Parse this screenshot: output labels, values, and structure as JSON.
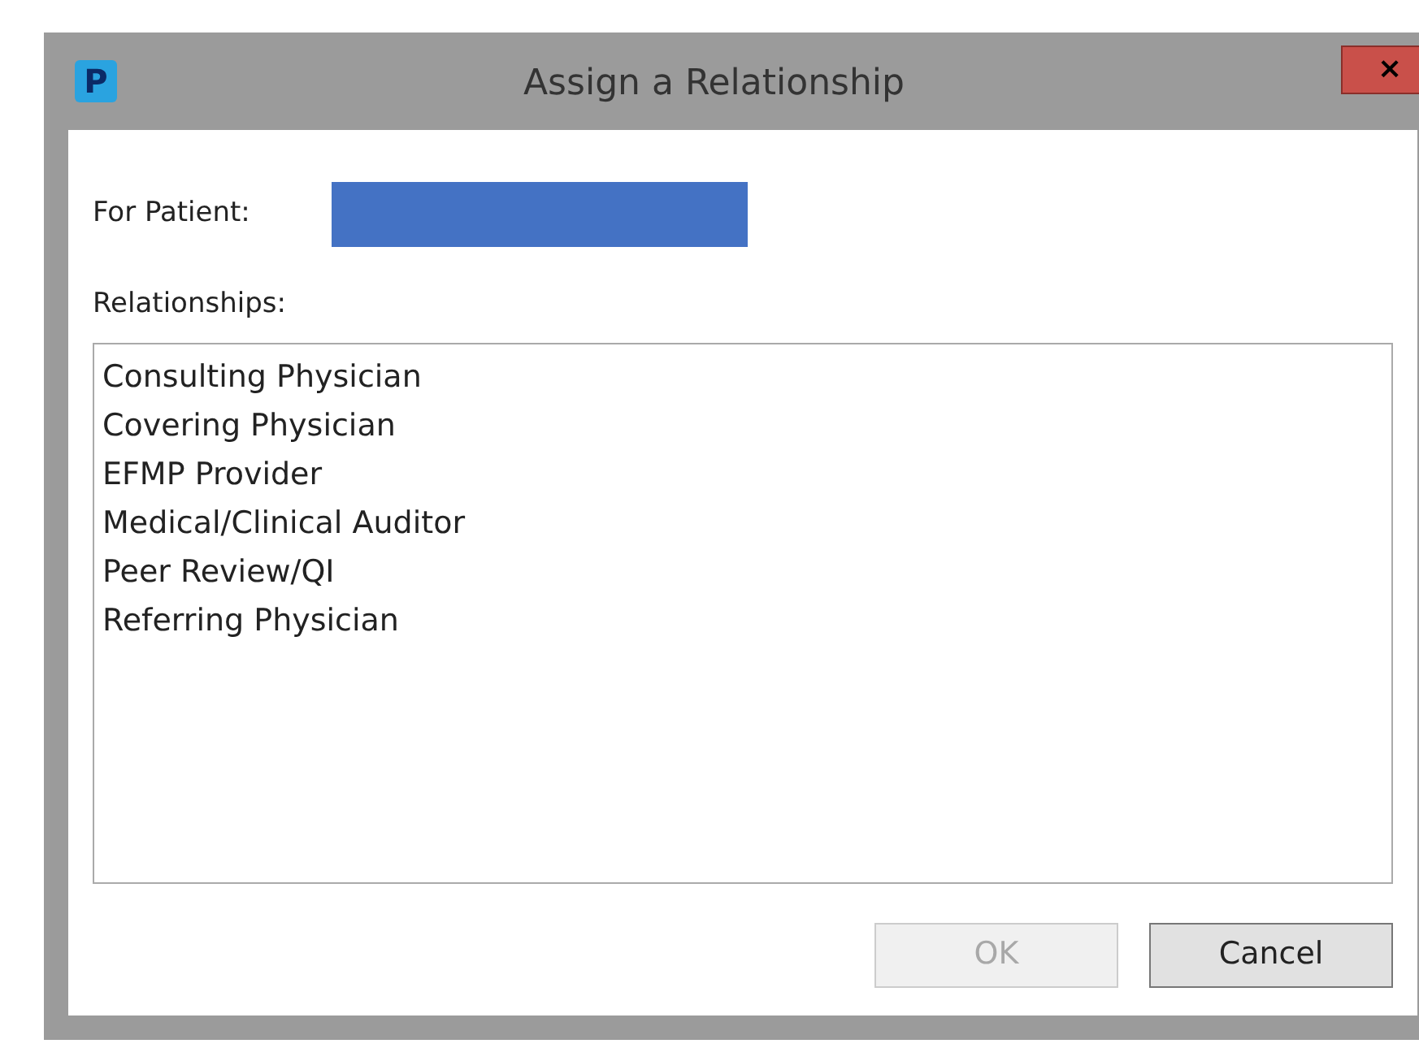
{
  "window": {
    "title": "Assign a Relationship",
    "app_icon": "P",
    "close": "×"
  },
  "patient": {
    "label": "For Patient:",
    "redacted": true
  },
  "relationships": {
    "label": "Relationships:",
    "items": [
      {
        "label": "Consulting Physician",
        "selected": false
      },
      {
        "label": "Covering Physician",
        "selected": false
      },
      {
        "label": "EFMP Provider",
        "selected": false
      },
      {
        "label": "Medical/Clinical Auditor",
        "selected": false
      },
      {
        "label": "Peer Review/QI",
        "selected": false
      },
      {
        "label": "Referring Physician",
        "selected": false
      }
    ]
  },
  "buttons": [
    {
      "label": "OK",
      "disabled": true
    },
    {
      "label": "Cancel",
      "disabled": false
    }
  ]
}
